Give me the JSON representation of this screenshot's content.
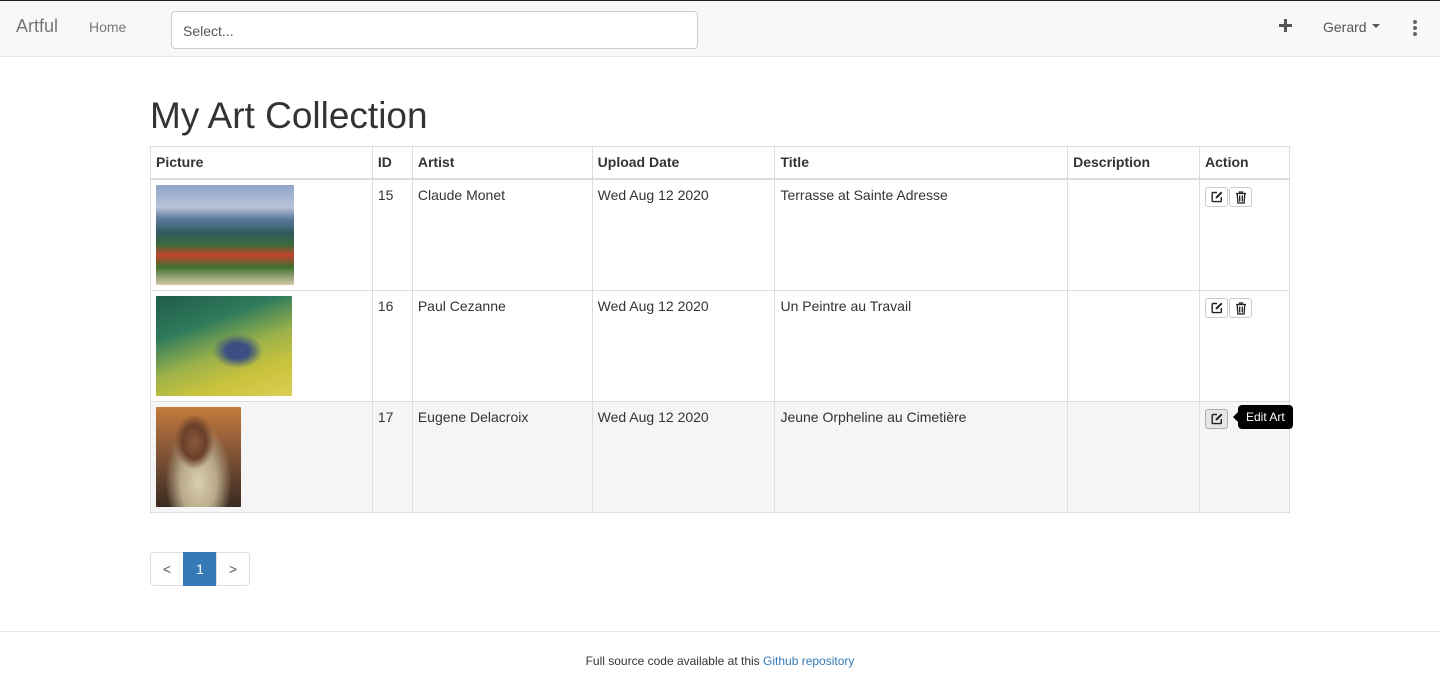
{
  "navbar": {
    "brand": "Artful",
    "home_label": "Home",
    "search_placeholder": "Select...",
    "user_name": "Gerard"
  },
  "page": {
    "title": "My Art Collection"
  },
  "table": {
    "headers": [
      "Picture",
      "ID",
      "Artist",
      "Upload Date",
      "Title",
      "Description",
      "Action"
    ],
    "rows": [
      {
        "id": "15",
        "artist": "Claude Monet",
        "upload_date": "Wed Aug 12 2020",
        "title": "Terrasse at Sainte Adresse",
        "description": ""
      },
      {
        "id": "16",
        "artist": "Paul Cezanne",
        "upload_date": "Wed Aug 12 2020",
        "title": "Un Peintre au Travail",
        "description": ""
      },
      {
        "id": "17",
        "artist": "Eugene Delacroix",
        "upload_date": "Wed Aug 12 2020",
        "title": "Jeune Orpheline au Cimetière",
        "description": ""
      }
    ]
  },
  "tooltip": {
    "text": "Edit Art"
  },
  "pagination": {
    "prev": "<",
    "current": "1",
    "next": ">"
  },
  "footer": {
    "text": "Full source code available at this ",
    "link_text": "Github repository"
  },
  "icons": {
    "add": "plus-icon",
    "menu": "kebab-icon",
    "edit": "edit-icon",
    "delete": "trash-icon"
  },
  "colors": {
    "primary": "#337ab7",
    "navbar_bg": "#f8f8f8",
    "tooltip_bg": "#000000"
  }
}
